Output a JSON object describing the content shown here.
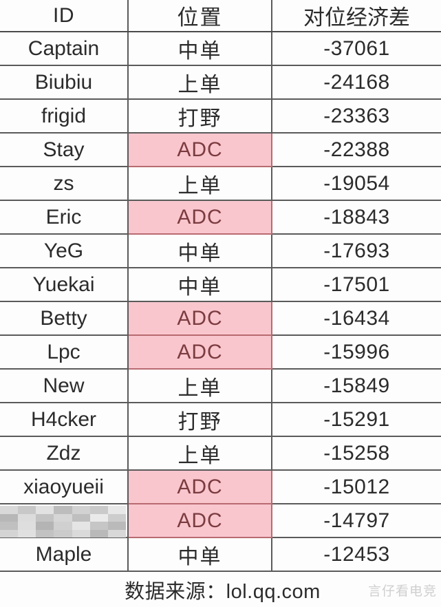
{
  "table": {
    "columns": [
      {
        "key": "id",
        "label": "ID"
      },
      {
        "key": "pos",
        "label": "位置"
      },
      {
        "key": "gold",
        "label": "对位经济差"
      }
    ],
    "highlight_value": "ADC",
    "highlight_fill": "#f9c6ce",
    "highlight_text": "#7b3c3f",
    "rows": [
      {
        "id": "Captain",
        "pos": "中单",
        "gold": "-37061",
        "censored": false
      },
      {
        "id": "Biubiu",
        "pos": "上单",
        "gold": "-24168",
        "censored": false
      },
      {
        "id": "frigid",
        "pos": "打野",
        "gold": "-23363",
        "censored": false
      },
      {
        "id": "Stay",
        "pos": "ADC",
        "gold": "-22388",
        "censored": false
      },
      {
        "id": "zs",
        "pos": "上单",
        "gold": "-19054",
        "censored": false
      },
      {
        "id": "Eric",
        "pos": "ADC",
        "gold": "-18843",
        "censored": false
      },
      {
        "id": "YeG",
        "pos": "中单",
        "gold": "-17693",
        "censored": false
      },
      {
        "id": "Yuekai",
        "pos": "中单",
        "gold": "-17501",
        "censored": false
      },
      {
        "id": "Betty",
        "pos": "ADC",
        "gold": "-16434",
        "censored": false
      },
      {
        "id": "Lpc",
        "pos": "ADC",
        "gold": "-15996",
        "censored": false
      },
      {
        "id": "New",
        "pos": "上单",
        "gold": "-15849",
        "censored": false
      },
      {
        "id": "H4cker",
        "pos": "打野",
        "gold": "-15291",
        "censored": false
      },
      {
        "id": "Zdz",
        "pos": "上单",
        "gold": "-15258",
        "censored": false
      },
      {
        "id": "xiaoyueii",
        "pos": "ADC",
        "gold": "-15012",
        "censored": false
      },
      {
        "id": "",
        "pos": "ADC",
        "gold": "-14797",
        "censored": true
      },
      {
        "id": "Maple",
        "pos": "中单",
        "gold": "-12453",
        "censored": false
      }
    ],
    "footer": {
      "source_label": "数据来源：",
      "source_value": "lol.qq.com"
    }
  },
  "watermark": {
    "text": "言仔看电竞"
  }
}
